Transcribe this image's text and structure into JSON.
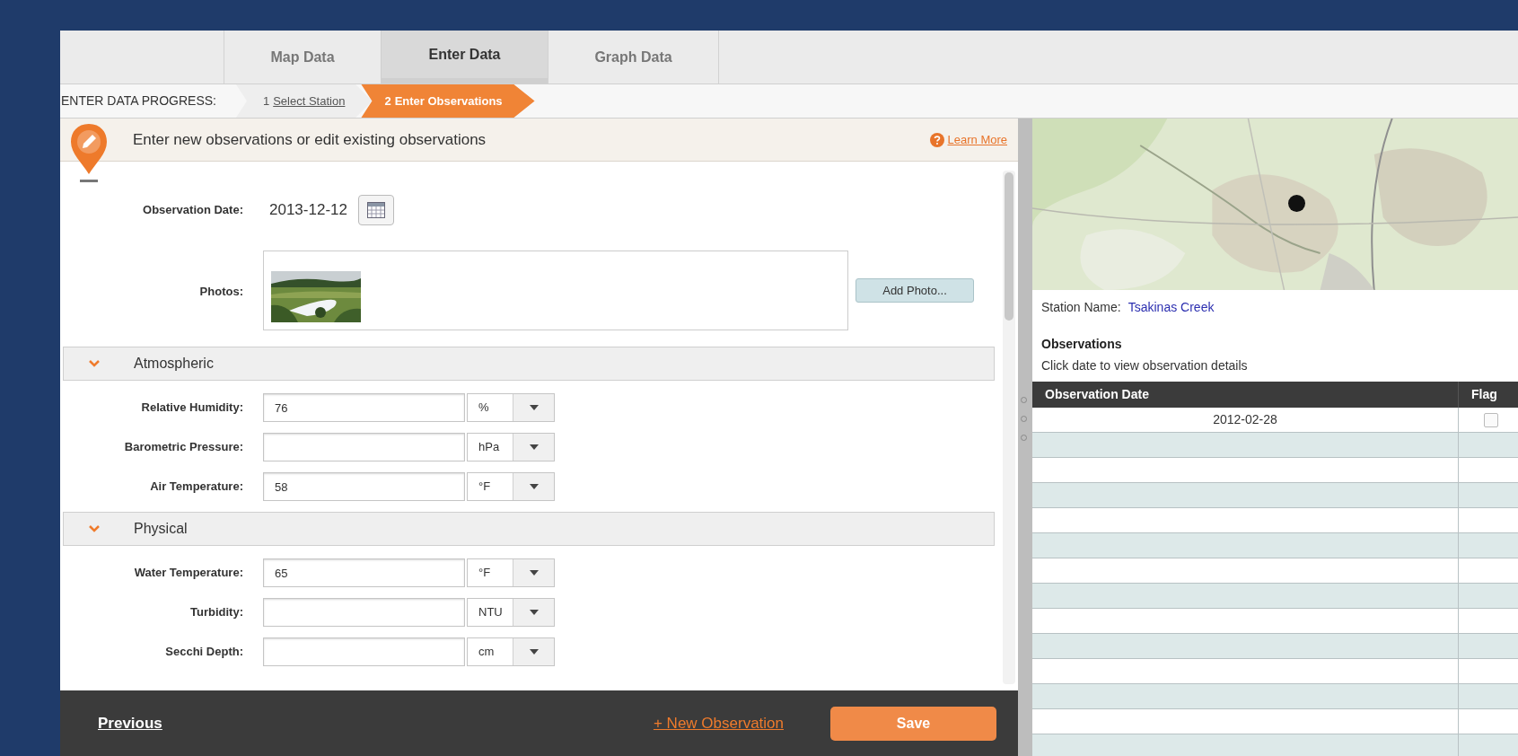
{
  "tabs": [
    {
      "label": "Map Data",
      "selected": false
    },
    {
      "label": "Enter Data",
      "selected": true
    },
    {
      "label": "Graph Data",
      "selected": false
    }
  ],
  "progress": {
    "label": "ENTER DATA PROGRESS:",
    "steps": [
      {
        "number": "1",
        "label": "Select Station",
        "selected": false
      },
      {
        "number": "2",
        "label": "Enter Observations",
        "selected": true
      }
    ]
  },
  "form_header": {
    "title": "Enter new observations or edit existing observations",
    "help_link": "Learn More"
  },
  "observation_date": {
    "label": "Observation Date:",
    "value": "2013-12-12"
  },
  "photos": {
    "label": "Photos:",
    "button": "Add Photo..."
  },
  "sections": [
    {
      "title": "Atmospheric",
      "expanded": true,
      "fields": [
        {
          "label": "Relative Humidity:",
          "value": "76",
          "unit": "%"
        },
        {
          "label": "Barometric Pressure:",
          "unit": "hPa"
        },
        {
          "label": "Air Temperature:",
          "value": "58",
          "unit": "°F"
        }
      ]
    },
    {
      "title": "Physical",
      "expanded": true,
      "fields": [
        {
          "label": "Water Temperature:",
          "value": "65",
          "unit": "°F"
        },
        {
          "label": "Turbidity:",
          "unit": "NTU"
        },
        {
          "label": "Secchi Depth:",
          "unit": "cm"
        }
      ]
    }
  ],
  "footer": {
    "previous": "Previous",
    "new_observation": "+ New Observation",
    "save": "Save"
  },
  "station": {
    "label": "Station Name:",
    "value": "Tsakinas Creek"
  },
  "observations": {
    "title": "Observations",
    "hint": "Click date to view observation details",
    "columns": [
      "Observation Date",
      "Flag"
    ],
    "rows": [
      {
        "date": "2012-02-28",
        "flagged": false
      }
    ]
  }
}
